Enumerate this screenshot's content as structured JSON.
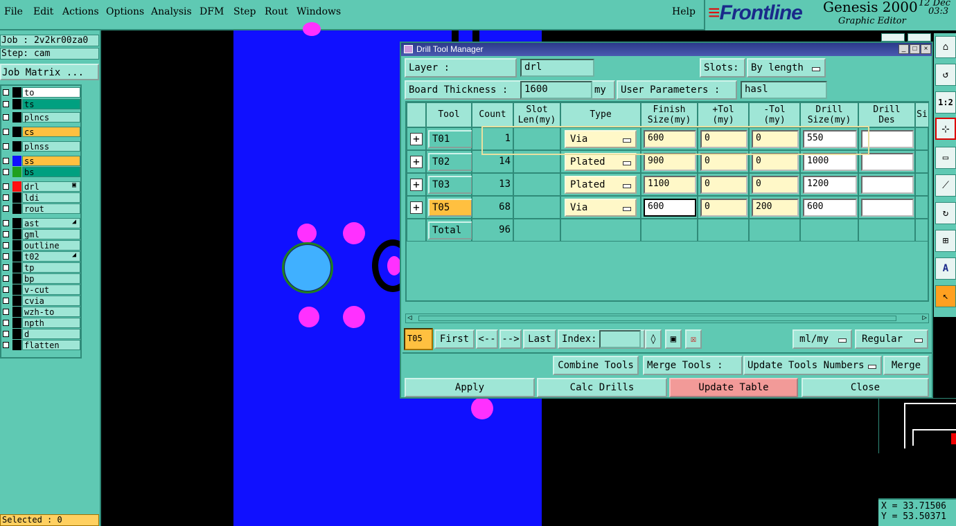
{
  "menu": [
    "File",
    "Edit",
    "Actions",
    "Options",
    "Analysis",
    "DFM",
    "Step",
    "Rout",
    "Windows"
  ],
  "help": "Help",
  "brand": {
    "logo": "Frontline",
    "product": "Genesis 2000",
    "subtitle": "Graphic Editor",
    "date": "12 Dec",
    "time": "03:3"
  },
  "left": {
    "job": "Job : 2v2kr00za0",
    "step": "Step: cam",
    "job_matrix": "Job Matrix ...",
    "selected": "Selected : 0",
    "layers": [
      {
        "name": "to",
        "color": "#ffffff",
        "swatch": "#000000"
      },
      {
        "name": "ts",
        "color": "#00a080",
        "swatch": "#000000"
      },
      {
        "name": "plncs",
        "color": "#9fe6d6",
        "swatch": "#000000"
      },
      {
        "name": "cs",
        "color": "#ffc040",
        "swatch": "#000000"
      },
      {
        "name": "plnss",
        "color": "#9fe6d6",
        "swatch": "#000000"
      },
      {
        "name": "ss",
        "color": "#ffc040",
        "swatch": "#1010ff"
      },
      {
        "name": "bs",
        "color": "#00a080",
        "swatch": "#20a020"
      },
      {
        "name": "drl",
        "color": "#9fe6d6",
        "swatch": "#ff1010"
      },
      {
        "name": "ldi",
        "color": "#9fe6d6",
        "swatch": "#000000"
      },
      {
        "name": "rout",
        "color": "#9fe6d6",
        "swatch": "#000000"
      },
      {
        "name": "ast",
        "color": "#9fe6d6",
        "swatch": "#000000"
      },
      {
        "name": "gml",
        "color": "#9fe6d6",
        "swatch": "#000000"
      },
      {
        "name": "outline",
        "color": "#9fe6d6",
        "swatch": "#000000"
      },
      {
        "name": "t02",
        "color": "#9fe6d6",
        "swatch": "#000000"
      },
      {
        "name": "tp",
        "color": "#9fe6d6",
        "swatch": "#000000"
      },
      {
        "name": "bp",
        "color": "#9fe6d6",
        "swatch": "#000000"
      },
      {
        "name": "v-cut",
        "color": "#9fe6d6",
        "swatch": "#000000"
      },
      {
        "name": "cvia",
        "color": "#9fe6d6",
        "swatch": "#000000"
      },
      {
        "name": "wzh-to",
        "color": "#9fe6d6",
        "swatch": "#000000"
      },
      {
        "name": "npth",
        "color": "#9fe6d6",
        "swatch": "#000000"
      },
      {
        "name": "d",
        "color": "#9fe6d6",
        "swatch": "#000000"
      },
      {
        "name": "flatten",
        "color": "#9fe6d6",
        "swatch": "#000000"
      }
    ]
  },
  "coords": {
    "x": "X = 33.71506",
    "y": "Y = 53.50371"
  },
  "dialog": {
    "title": "Drill Tool Manager",
    "layer_label": "Layer        :",
    "layer_value": "drl",
    "slots_label": "Slots:",
    "slots_value": "By length",
    "board_label": "Board Thickness :",
    "board_value": "1600",
    "board_unit": "my",
    "user_params_label": "User Parameters :",
    "user_params_value": "hasl",
    "headers": [
      "Tool",
      "Count",
      "Slot\nLen(my)",
      "Type",
      "Finish\nSize(my)",
      "+Tol\n(my)",
      "-Tol\n(my)",
      "Drill\nSize(my)",
      "Drill\nDes",
      "Si"
    ],
    "rows": [
      {
        "tool": "T01",
        "count": "1",
        "type": "Via",
        "finish": "600",
        "ptol": "0",
        "mtol": "0",
        "drill": "550"
      },
      {
        "tool": "T02",
        "count": "14",
        "type": "Plated",
        "finish": "900",
        "ptol": "0",
        "mtol": "0",
        "drill": "1000"
      },
      {
        "tool": "T03",
        "count": "13",
        "type": "Plated",
        "finish": "1100",
        "ptol": "0",
        "mtol": "0",
        "drill": "1200"
      },
      {
        "tool": "T05",
        "count": "68",
        "type": "Via",
        "finish": "600",
        "ptol": "0",
        "mtol": "200",
        "drill": "600"
      }
    ],
    "total_label": "Total",
    "total_count": "96",
    "current_tool": "T05",
    "nav": {
      "first": "First",
      "prev": "<--",
      "next": "-->",
      "last": "Last",
      "index": "Index:"
    },
    "units": "ml/my",
    "mode": "Regular",
    "combine": "Combine Tools",
    "merge_label": "Merge Tools :",
    "merge_option": "Update Tools Numbers",
    "merge": "Merge",
    "apply": "Apply",
    "calc": "Calc Drills",
    "update": "Update Table",
    "close": "Close"
  }
}
